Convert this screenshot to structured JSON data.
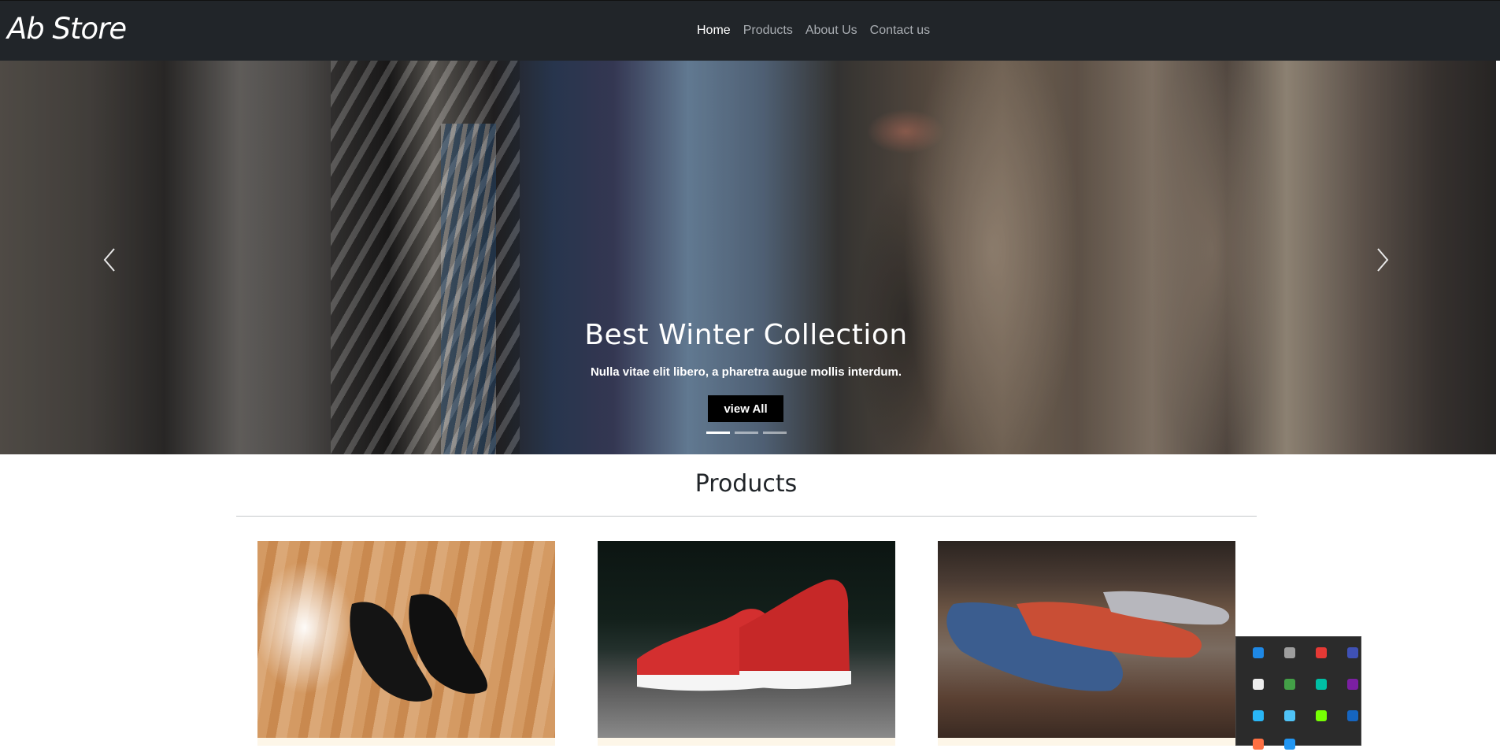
{
  "brand": "Ab Store",
  "nav": {
    "home": "Home",
    "products": "Products",
    "about": "About Us",
    "contact": "Contact us"
  },
  "hero": {
    "title": "Best Winter Collection",
    "subtitle": "Nulla vitae elit libero, a pharetra augue mollis interdum.",
    "cta": "view All",
    "slide_count": 3,
    "active_slide": 1
  },
  "products_section": {
    "title": "Products"
  },
  "products": [
    {
      "image_desc": "black-dress-shoes"
    },
    {
      "image_desc": "red-sneakers"
    },
    {
      "image_desc": "loafers"
    }
  ],
  "tray": {
    "icons": [
      "#1e88e5",
      "#9e9e9e",
      "#e53935",
      "#3f51b5",
      "#eeeeee",
      "#43a047",
      "#00bfa5",
      "#7b1fa2",
      "#29b6f6",
      "#4fc3f7",
      "#76ff03",
      "#1565c0",
      "#ff7043",
      "#2196f3"
    ]
  }
}
